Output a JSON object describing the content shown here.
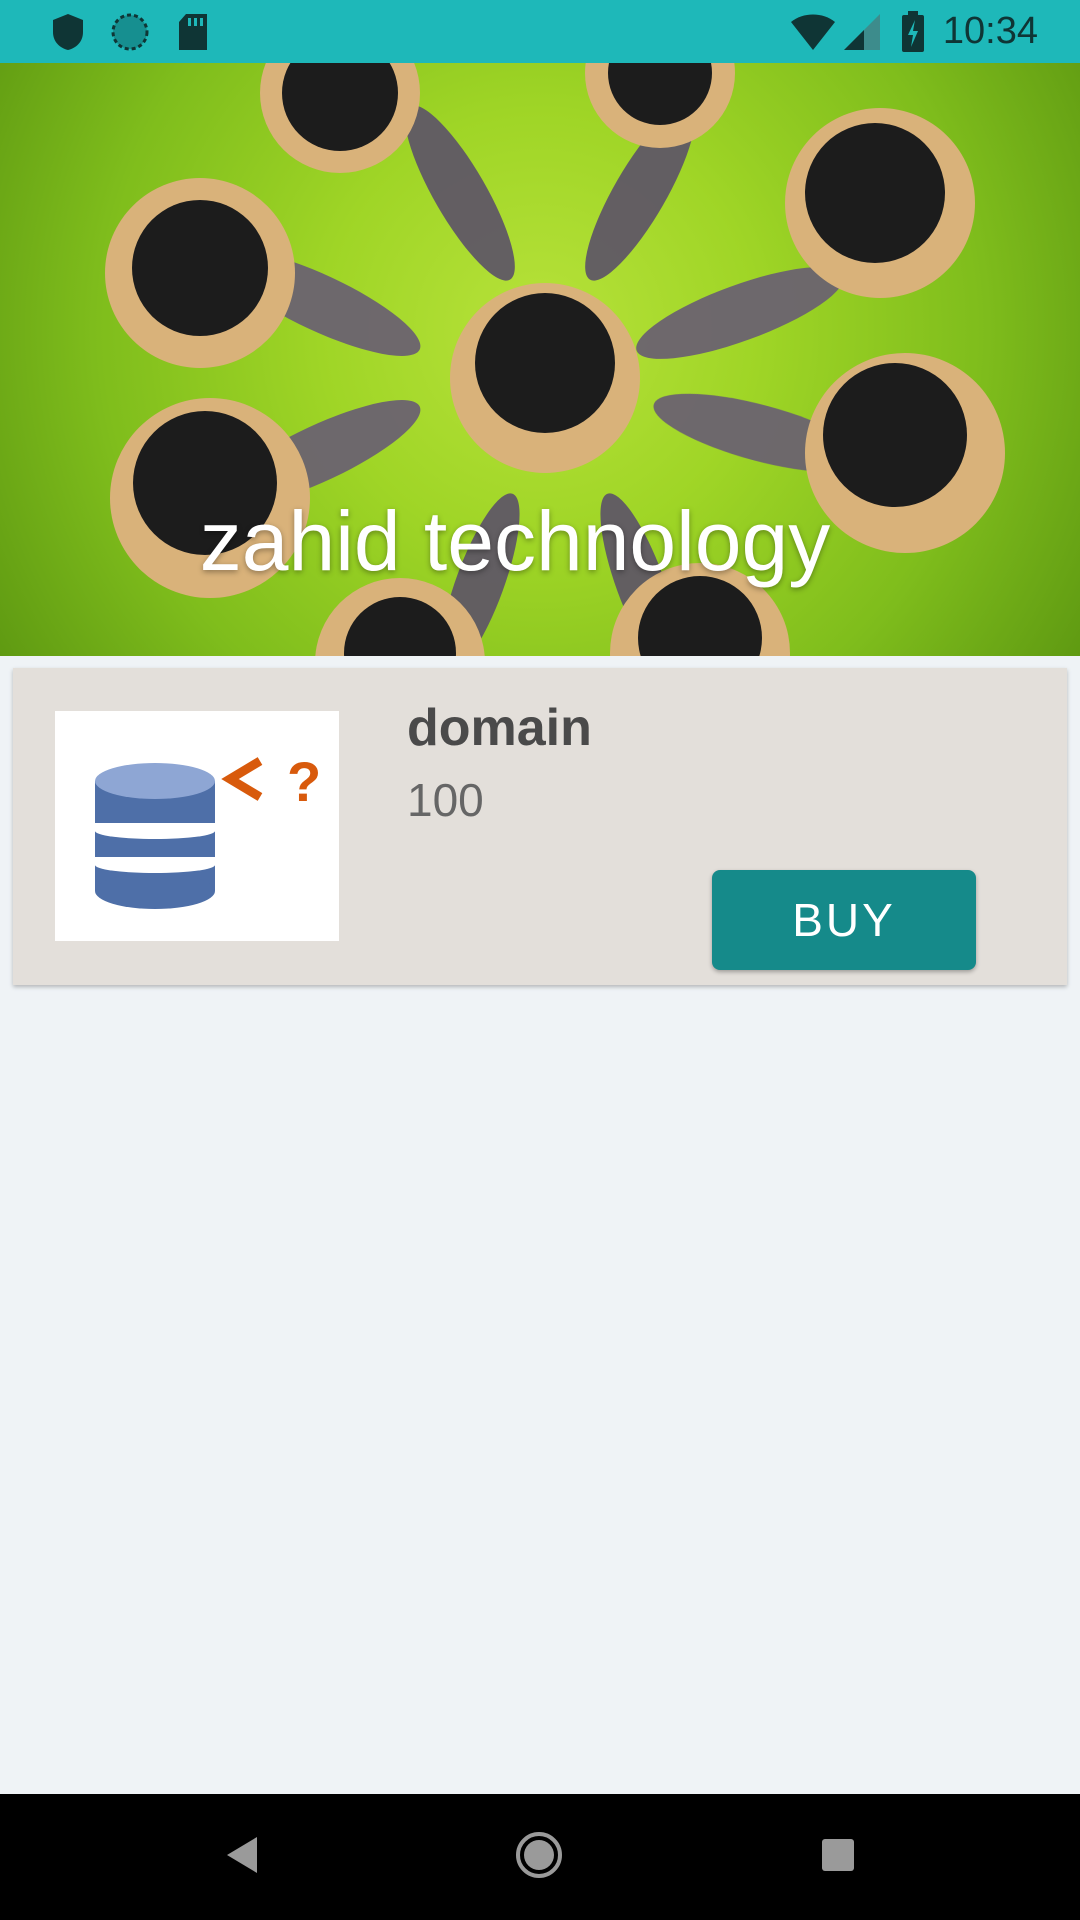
{
  "status_bar": {
    "time": "10:34",
    "left_icons": [
      "shield-icon",
      "sync-icon",
      "sd-card-icon"
    ],
    "right_icons": [
      "wifi-icon",
      "signal-icon",
      "battery-charging-icon"
    ],
    "background": "#1eb8b9"
  },
  "hero": {
    "title": "zahid technology"
  },
  "product": {
    "name": "domain",
    "price": "100",
    "image_icon": "database-icon",
    "buy_label": "BUY",
    "card_color": "#e3dfda",
    "button_color": "#158a8a"
  },
  "nav_bar": {
    "buttons": [
      "back-icon",
      "home-icon",
      "recents-icon"
    ]
  }
}
